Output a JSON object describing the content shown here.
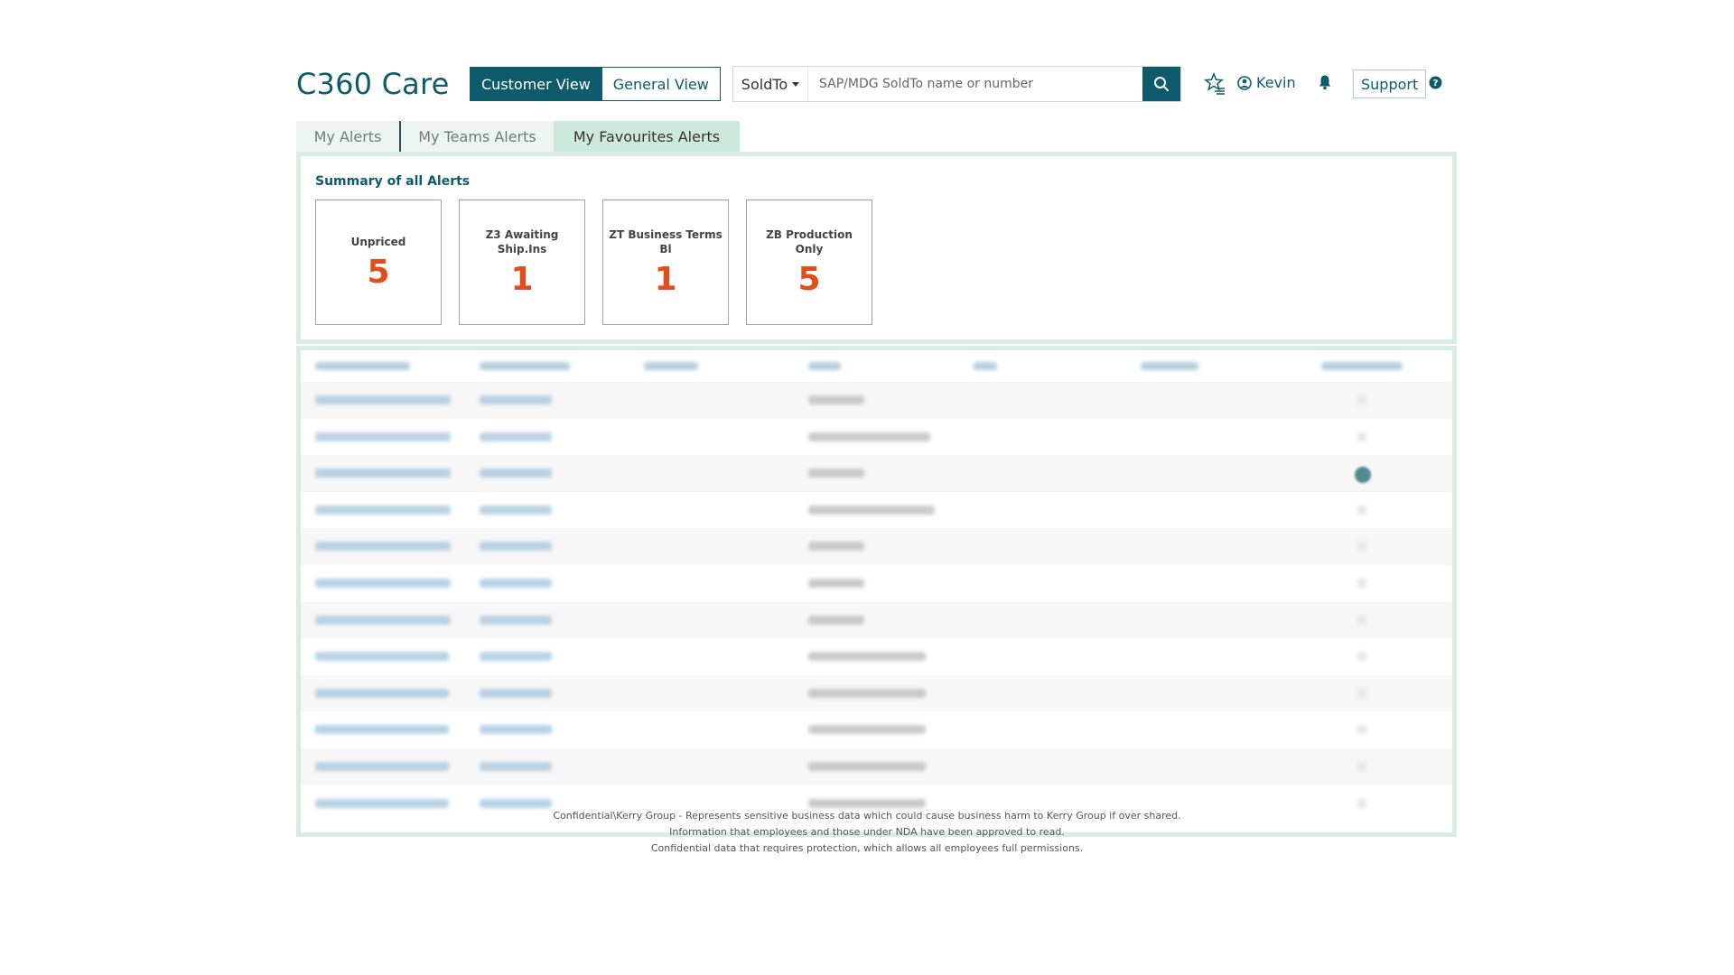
{
  "header": {
    "app_title": "C360 Care",
    "view_customer": "Customer View",
    "view_general": "General View",
    "search_select": "SoldTo",
    "search_placeholder": "SAP/MDG SoldTo name or number",
    "user_name": "Kevin",
    "support_label": "Support"
  },
  "tabs": [
    {
      "label": "My Alerts",
      "active": false
    },
    {
      "label": "My Teams Alerts",
      "active": false
    },
    {
      "label": "My Favourites Alerts",
      "active": true
    }
  ],
  "summary": {
    "title": "Summary of all Alerts",
    "cards": [
      {
        "label": "Unpriced",
        "value": "5"
      },
      {
        "label": "Z3 Awaiting Ship.Ins",
        "value": "1"
      },
      {
        "label": "ZT Business Terms Bl",
        "value": "1"
      },
      {
        "label": "ZB Production Only",
        "value": "5"
      }
    ]
  },
  "footer": {
    "line1": "Confidential\\Kerry Group - Represents sensitive business data which could cause business harm to Kerry Group if over shared.",
    "line2": "Information that employees and those under NDA have been approved to read.",
    "line3": "Confidential data that requires protection, which allows all employees full permissions."
  },
  "colors": {
    "brand": "#0d5b6b",
    "alert_value": "#e04e1b",
    "panel_border": "#d8ece2",
    "active_tab": "#cfe8dd"
  },
  "icons": {
    "search": "search-icon",
    "favourites": "star-list-icon",
    "user": "user-circle-icon",
    "notifications": "bell-icon",
    "help": "question-circle-icon"
  }
}
